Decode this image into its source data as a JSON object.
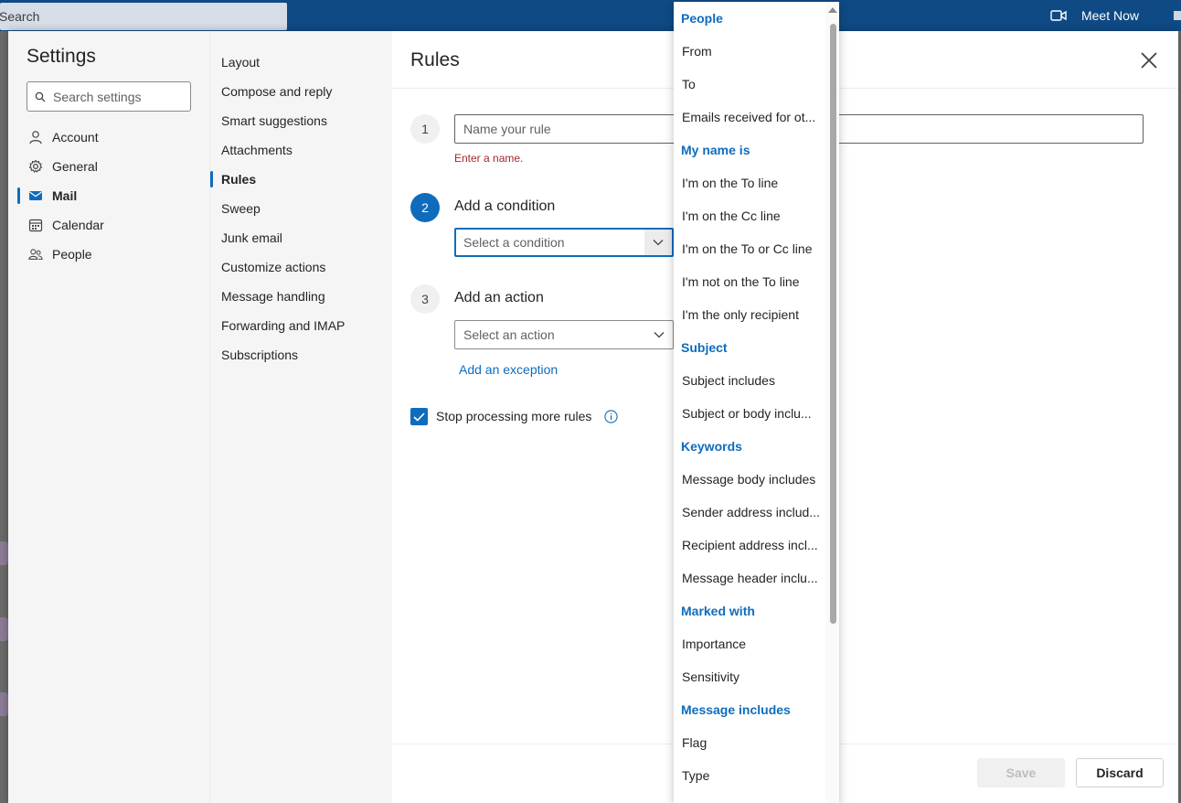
{
  "topbar": {
    "search_text": "Search",
    "meet_now": "Meet Now"
  },
  "settings": {
    "title": "Settings",
    "search_placeholder": "Search settings",
    "categories": [
      {
        "label": "Account",
        "icon": "person-icon",
        "active": false
      },
      {
        "label": "General",
        "icon": "gear-icon",
        "active": false
      },
      {
        "label": "Mail",
        "icon": "mail-icon",
        "active": true
      },
      {
        "label": "Calendar",
        "icon": "calendar-icon",
        "active": false
      },
      {
        "label": "People",
        "icon": "people-icon",
        "active": false
      }
    ],
    "subcategories": [
      {
        "label": "Layout",
        "active": false
      },
      {
        "label": "Compose and reply",
        "active": false
      },
      {
        "label": "Smart suggestions",
        "active": false
      },
      {
        "label": "Attachments",
        "active": false
      },
      {
        "label": "Rules",
        "active": true
      },
      {
        "label": "Sweep",
        "active": false
      },
      {
        "label": "Junk email",
        "active": false
      },
      {
        "label": "Customize actions",
        "active": false
      },
      {
        "label": "Message handling",
        "active": false
      },
      {
        "label": "Forwarding and IMAP",
        "active": false
      },
      {
        "label": "Subscriptions",
        "active": false
      }
    ]
  },
  "rules": {
    "title": "Rules",
    "step1": {
      "number": "1",
      "name_placeholder": "Name your rule",
      "error": "Enter a name."
    },
    "step2": {
      "number": "2",
      "label": "Add a condition",
      "placeholder": "Select a condition"
    },
    "step3": {
      "number": "3",
      "label": "Add an action",
      "placeholder": "Select an action"
    },
    "add_exception": "Add an exception",
    "stop_processing": {
      "label": "Stop processing more rules",
      "checked": true
    },
    "save_label": "Save",
    "discard_label": "Discard"
  },
  "condition_menu": {
    "rows": [
      {
        "text": "People",
        "kind": "header"
      },
      {
        "text": "From",
        "kind": "option"
      },
      {
        "text": "To",
        "kind": "option"
      },
      {
        "text": "Emails received for ot...",
        "kind": "option"
      },
      {
        "text": "My name is",
        "kind": "header"
      },
      {
        "text": "I'm on the To line",
        "kind": "option"
      },
      {
        "text": "I'm on the Cc line",
        "kind": "option"
      },
      {
        "text": "I'm on the To or Cc line",
        "kind": "option"
      },
      {
        "text": "I'm not on the To line",
        "kind": "option"
      },
      {
        "text": "I'm the only recipient",
        "kind": "option"
      },
      {
        "text": "Subject",
        "kind": "header"
      },
      {
        "text": "Subject includes",
        "kind": "option"
      },
      {
        "text": "Subject or body inclu...",
        "kind": "option"
      },
      {
        "text": "Keywords",
        "kind": "header"
      },
      {
        "text": "Message body includes",
        "kind": "option"
      },
      {
        "text": "Sender address includ...",
        "kind": "option"
      },
      {
        "text": "Recipient address incl...",
        "kind": "option"
      },
      {
        "text": "Message header inclu...",
        "kind": "option"
      },
      {
        "text": "Marked with",
        "kind": "header"
      },
      {
        "text": "Importance",
        "kind": "option"
      },
      {
        "text": "Sensitivity",
        "kind": "option"
      },
      {
        "text": "Message includes",
        "kind": "header"
      },
      {
        "text": "Flag",
        "kind": "option"
      },
      {
        "text": "Type",
        "kind": "option"
      }
    ]
  },
  "colors": {
    "accent": "#0f6cbd",
    "topbar": "#0f4a85",
    "error": "#a4262c"
  }
}
